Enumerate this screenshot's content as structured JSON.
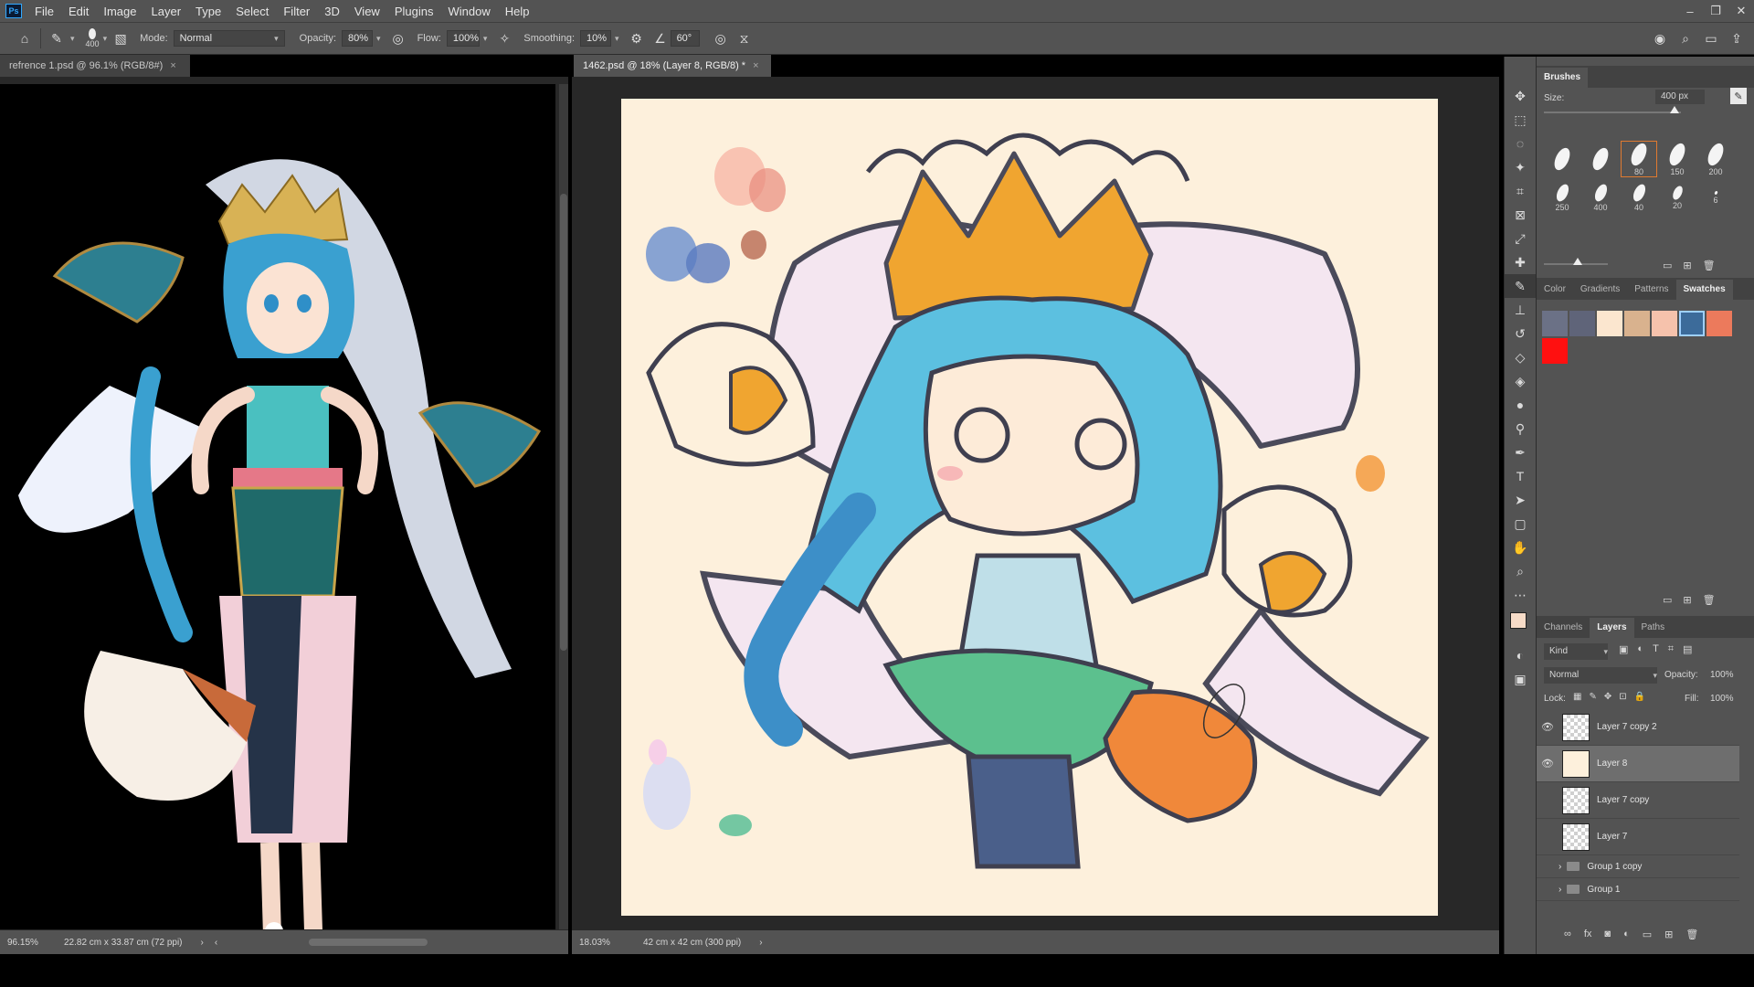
{
  "menu": {
    "logo": "Ps",
    "items": [
      "File",
      "Edit",
      "Image",
      "Layer",
      "Type",
      "Select",
      "Filter",
      "3D",
      "View",
      "Plugins",
      "Window",
      "Help"
    ]
  },
  "options": {
    "brush_size": "400",
    "mode_label": "Mode:",
    "mode_value": "Normal",
    "opacity_label": "Opacity:",
    "opacity_value": "80%",
    "flow_label": "Flow:",
    "flow_value": "100%",
    "smoothing_label": "Smoothing:",
    "smoothing_value": "10%",
    "angle_value": "60°"
  },
  "tabs": {
    "left": "refrence 1.psd @ 96.1% (RGB/8#)",
    "right": "1462.psd @ 18% (Layer 8, RGB/8) *"
  },
  "status": {
    "left_zoom": "96.15%",
    "left_size": "22.82 cm x 33.87 cm (72 ppi)",
    "right_zoom": "18.03%",
    "right_size": "42 cm x 42 cm (300 ppi)"
  },
  "brushes": {
    "title": "Brushes",
    "size_label": "Size:",
    "size_value": "400 px",
    "presets": [
      "",
      "",
      "80",
      "150",
      "200",
      "250",
      "400",
      "40",
      "20",
      "6"
    ]
  },
  "swatch_tabs": [
    "Color",
    "Gradients",
    "Patterns",
    "Swatches"
  ],
  "swatches": [
    "#6b7186",
    "#5f6479",
    "#fbe6cf",
    "#d9b28e",
    "#f6c2ac",
    "#3c6b9a",
    "#ec7a5c",
    "#ff1010"
  ],
  "layers_panel": {
    "tabs": [
      "Channels",
      "Layers",
      "Paths"
    ],
    "kind": "Kind",
    "blend": "Normal",
    "opacity_label": "Opacity:",
    "opacity_value": "100%",
    "lock_label": "Lock:",
    "fill_label": "Fill:",
    "fill_value": "100%",
    "layers": [
      {
        "name": "Layer 7 copy 2",
        "visible": true
      },
      {
        "name": "Layer 8",
        "visible": true,
        "selected": true
      },
      {
        "name": "Layer 7 copy",
        "visible": false
      },
      {
        "name": "Layer 7",
        "visible": false
      }
    ],
    "groups": [
      "Group 1 copy",
      "Group 1"
    ]
  },
  "colors": {
    "foreground": "#f7dcc8",
    "background": "#5fa05a"
  }
}
